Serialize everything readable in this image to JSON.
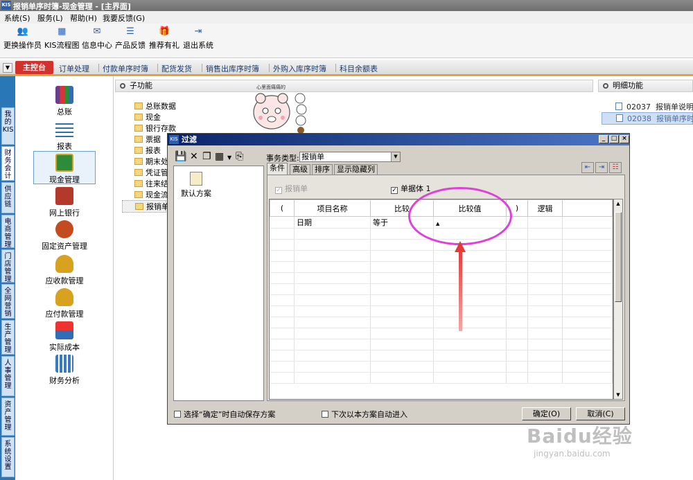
{
  "window": {
    "title": "报销单序时簿-现金管理 - [主界面]",
    "icon_text": "KIS"
  },
  "menu": [
    "系统(S)",
    "服务(L)",
    "帮助(H)",
    "我要反馈(G)"
  ],
  "toolbar": [
    {
      "label": "更换操作员",
      "icon": "user-switch-icon"
    },
    {
      "label": "KIS流程图",
      "icon": "flowchart-icon"
    },
    {
      "label": "信息中心",
      "icon": "message-icon"
    },
    {
      "label": "产品反馈",
      "icon": "feedback-icon"
    },
    {
      "label": "推荐有礼",
      "icon": "gift-icon"
    },
    {
      "label": "退出系统",
      "icon": "exit-icon"
    }
  ],
  "tabs": {
    "home": "主控台",
    "items": [
      "订单处理",
      "付款单序时簿",
      "配货发货",
      "销售出库序时簿",
      "外购入库序时簿",
      "科目余额表"
    ]
  },
  "vertical_tabs": [
    "我的KIS",
    "财务会计",
    "供应链",
    "电商管理",
    "门店管理",
    "全网营销",
    "生产管理",
    "人事管理",
    "资产管理",
    "系统设置"
  ],
  "nav": [
    {
      "label": "总账",
      "icon": "ledger-icon",
      "color": "#6a3d8f"
    },
    {
      "label": "报表",
      "icon": "report-icon",
      "color": "#2f6db5"
    },
    {
      "label": "现金管理",
      "icon": "cash-icon",
      "color": "#2e8b3a",
      "selected": true
    },
    {
      "label": "网上银行",
      "icon": "bank-icon",
      "color": "#b33a2a"
    },
    {
      "label": "固定资产管理",
      "icon": "fixed-asset-icon",
      "color": "#c44a20"
    },
    {
      "label": "应收款管理",
      "icon": "receivable-icon",
      "color": "#d8a21e"
    },
    {
      "label": "应付款管理",
      "icon": "payable-icon",
      "color": "#d8a21e"
    },
    {
      "label": "实际成本",
      "icon": "cost-icon",
      "color": "#2f6db5"
    },
    {
      "label": "财务分析",
      "icon": "analysis-icon",
      "color": "#3a7ac4"
    }
  ],
  "subfunc": {
    "header": "子功能",
    "items": [
      "总账数据",
      "现金",
      "银行存款",
      "票据",
      "报表",
      "期末处",
      "凭证管",
      "往来结",
      "现金流",
      "报销单"
    ],
    "mascot_text": "心里面痛痛的"
  },
  "detail": {
    "header": "明细功能",
    "items": [
      {
        "code": "02037",
        "name": "报销单说明"
      },
      {
        "code": "02038",
        "name": "报销单序时簿"
      }
    ]
  },
  "dialog": {
    "title": "过滤",
    "scheme": "默认方案",
    "type_label": "事务类型:",
    "type_value": "报销单",
    "tabs": [
      "条件",
      "高级",
      "排序",
      "显示隐藏列"
    ],
    "check_bill": "报销单",
    "check_body": "单据体 1",
    "columns": [
      "(",
      "项目名称",
      "比较",
      "比较值",
      ")",
      "逻辑"
    ],
    "row": {
      "item": "日期",
      "compare": "等于"
    },
    "auto_save": "选择“确定”时自动保存方案",
    "auto_enter": "下次以本方案自动进入",
    "ok": "确定(O)",
    "cancel": "取消(C)"
  },
  "watermark": {
    "brand": "Baidu经验",
    "url": "jingyan.baidu.com"
  },
  "colors": {
    "accent": "#d2322d",
    "highlight_ellipse": "#e03fd8",
    "arrow": "#e43a3a",
    "dialog_title": "#0a246a"
  }
}
